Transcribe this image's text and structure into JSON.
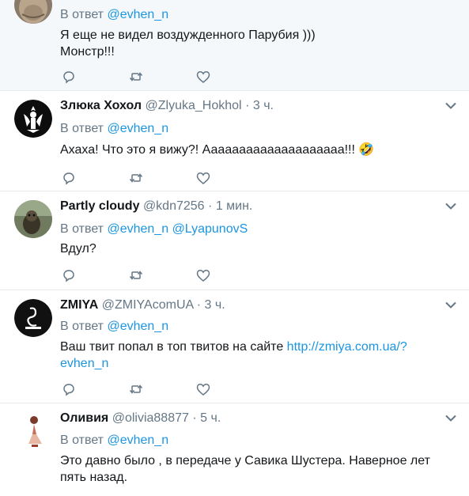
{
  "tweets": [
    {
      "name": "",
      "handle": "",
      "time": "",
      "reply_prefix": "В ответ",
      "mentions": [
        "@evhen_n"
      ],
      "lines": [
        "Я еще не видел воздужденного Парубия )))",
        "Монстр!!!"
      ],
      "avatar_icon": "old-man-photo"
    },
    {
      "name": "Злюка Хохол",
      "handle": "@Zlyuka_Hokhol",
      "time": "3 ч.",
      "reply_prefix": "В ответ",
      "mentions": [
        "@evhen_n"
      ],
      "text": "Ахаха! Что это я вижу?! Аааааааааааааааааааа!!!",
      "emoji": "🤣",
      "avatar_icon": "coat-of-arms-logo"
    },
    {
      "name": "Partly cloudy",
      "handle": "@kdn7256",
      "time": "1 мин.",
      "reply_prefix": "В ответ",
      "mentions": [
        "@evhen_n",
        "@LyapunovS"
      ],
      "text": "Вдул?",
      "avatar_icon": "animal-photo"
    },
    {
      "name": "ZMIYA",
      "handle": "@ZMIYAcomUA",
      "time": "3 ч.",
      "reply_prefix": "В ответ",
      "mentions": [
        "@evhen_n"
      ],
      "text": "Ваш твит попал в топ твитов на сайте",
      "link_line1": "http://zmiya.com.ua/?",
      "link_line2": "evhen_n",
      "avatar_icon": "snake-logo"
    },
    {
      "name": "Оливия",
      "handle": "@olivia88877",
      "time": "5 ч.",
      "reply_prefix": "В ответ",
      "mentions": [
        "@evhen_n"
      ],
      "text": "Это давно было , в передаче у Савика Шустера. Наверное лет пять назад.",
      "avatar_icon": "woman-illustration"
    }
  ],
  "separator": "·",
  "colors": {
    "link": "#1b95e0",
    "muted": "#657786",
    "text": "#14171a",
    "highlight_bg": "#f5f8fa"
  },
  "action_icons": [
    "reply-icon",
    "retweet-icon",
    "like-icon"
  ]
}
